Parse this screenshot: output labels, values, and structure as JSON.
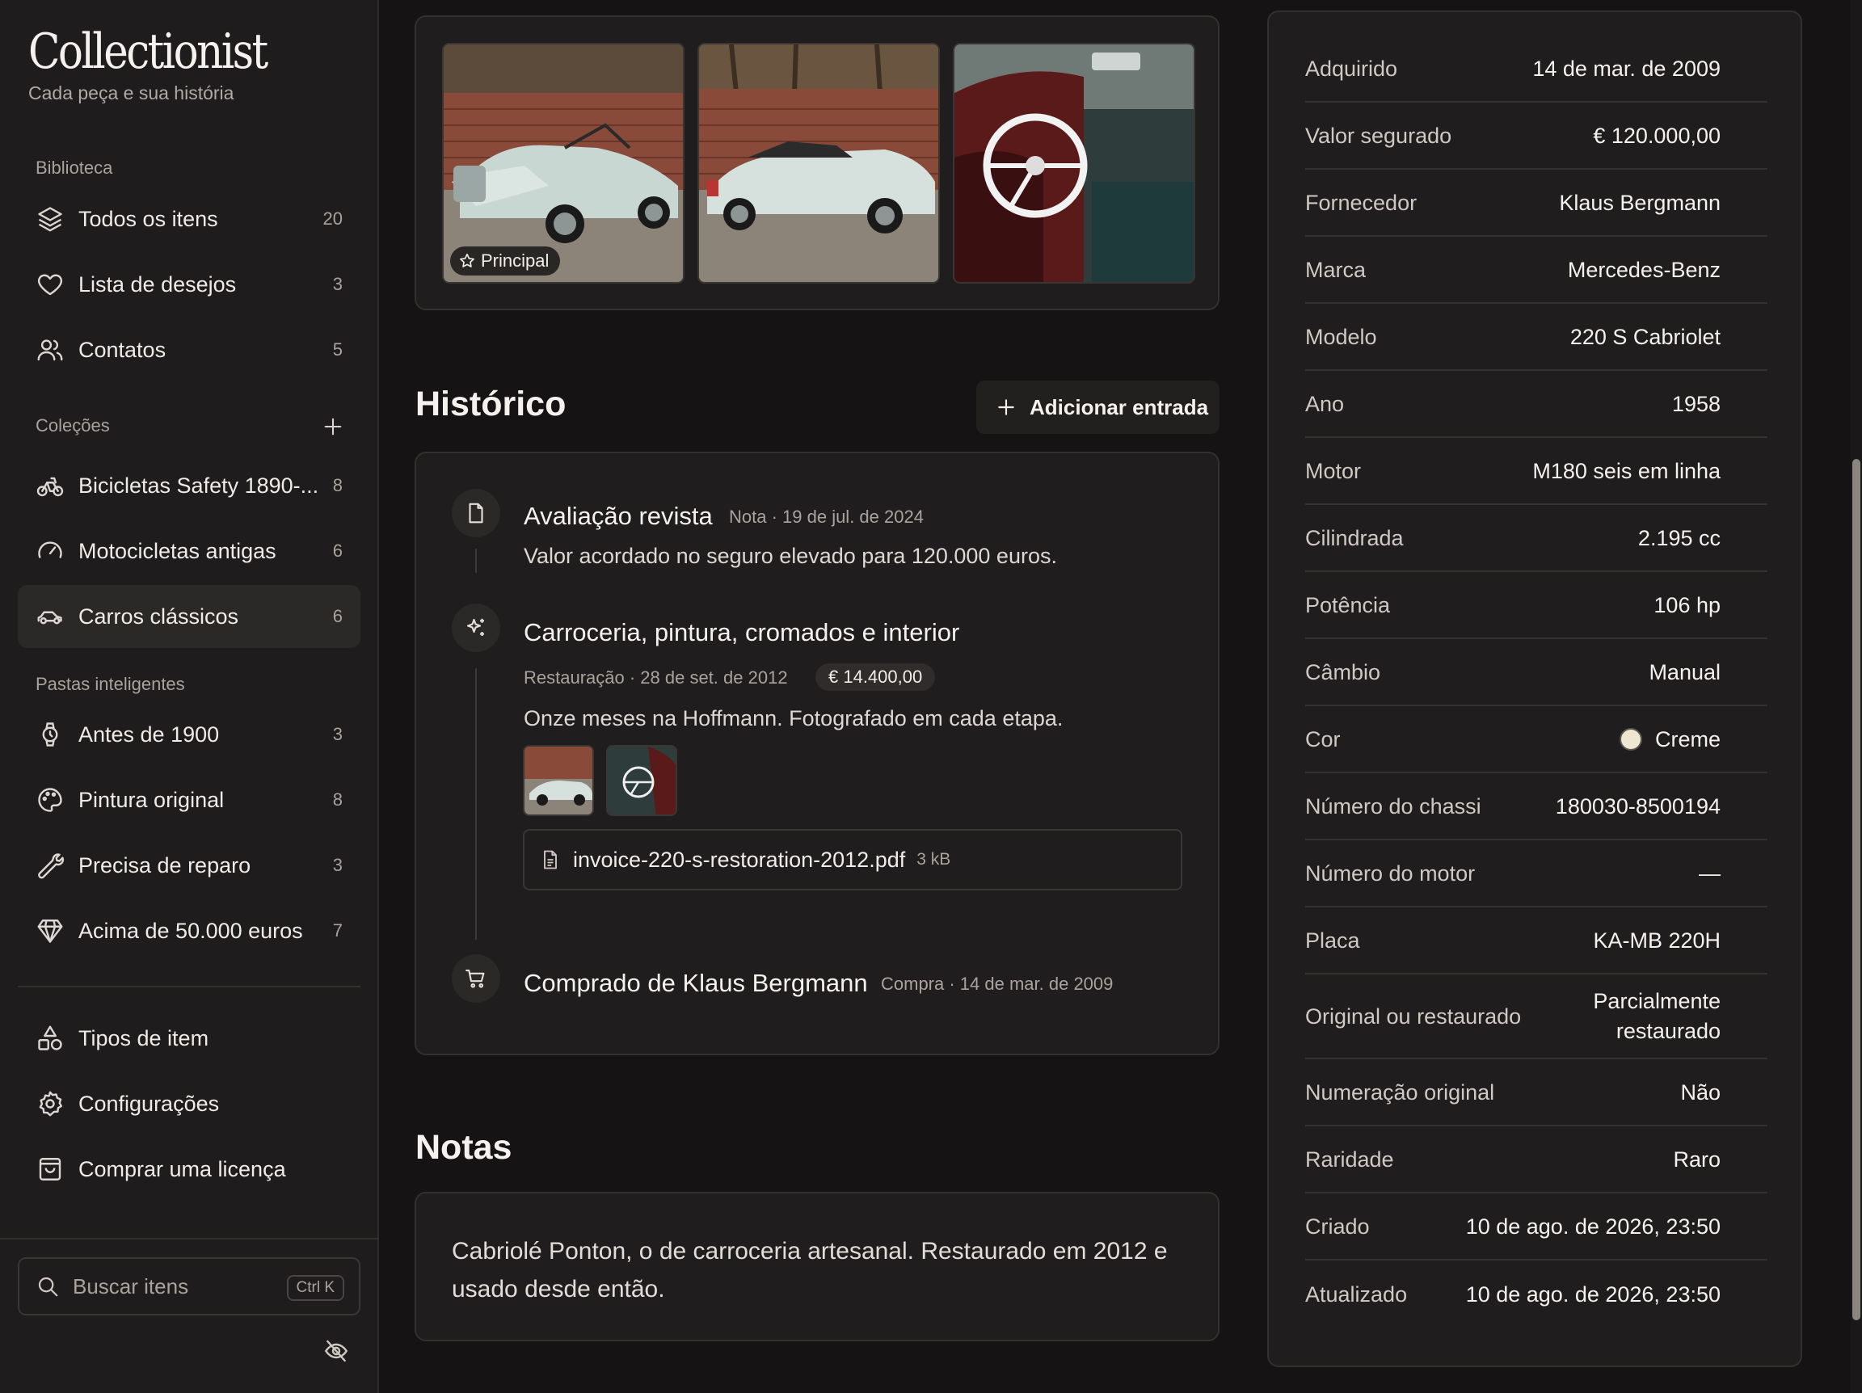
{
  "brand": {
    "name": "Collectionist",
    "tagline": "Cada peça e sua história"
  },
  "sidebar": {
    "library_label": "Biblioteca",
    "library": [
      {
        "icon": "layers-icon",
        "label": "Todos os itens",
        "count": "20"
      },
      {
        "icon": "heart-icon",
        "label": "Lista de desejos",
        "count": "3"
      },
      {
        "icon": "users-icon",
        "label": "Contatos",
        "count": "5"
      }
    ],
    "collections_label": "Coleções",
    "collections": [
      {
        "icon": "bicycle-icon",
        "label": "Bicicletas Safety 1890-...",
        "count": "8"
      },
      {
        "icon": "gauge-icon",
        "label": "Motocicletas antigas",
        "count": "6"
      },
      {
        "icon": "car-icon",
        "label": "Carros clássicos",
        "count": "6",
        "active": true
      }
    ],
    "smart_label": "Pastas inteligentes",
    "smart": [
      {
        "icon": "watch-icon",
        "label": "Antes de 1900",
        "count": "3"
      },
      {
        "icon": "palette-icon",
        "label": "Pintura original",
        "count": "8"
      },
      {
        "icon": "wrench-icon",
        "label": "Precisa de reparo",
        "count": "3"
      },
      {
        "icon": "diamond-icon",
        "label": "Acima de 50.000 euros",
        "count": "7"
      }
    ],
    "footer": [
      {
        "icon": "shapes-icon",
        "label": "Tipos de item"
      },
      {
        "icon": "gear-icon",
        "label": "Configurações"
      },
      {
        "icon": "shopping-bag-icon",
        "label": "Comprar uma licença"
      }
    ],
    "search": {
      "placeholder": "Buscar itens",
      "shortcut": "Ctrl K"
    }
  },
  "gallery": {
    "primary_badge": "Principal"
  },
  "history": {
    "title": "Histórico",
    "add_label": "Adicionar entrada",
    "events": [
      {
        "icon": "file-icon",
        "title": "Avaliação revista",
        "meta": "Nota · 19 de jul. de 2024",
        "text": "Valor acordado no seguro elevado para 120.000 euros."
      },
      {
        "icon": "sparkles-icon",
        "title": "Carroceria, pintura, cromados e interior",
        "meta": "Restauração · 28 de set. de 2012",
        "price": "€ 14.400,00",
        "text": "Onze meses na Hoffmann. Fotografado em cada etapa.",
        "attachment": {
          "name": "invoice-220-s-restoration-2012.pdf",
          "size": "3 kB"
        }
      },
      {
        "icon": "cart-icon",
        "title": "Comprado de Klaus Bergmann",
        "meta": "Compra · 14 de mar. de 2009"
      }
    ]
  },
  "notes": {
    "title": "Notas",
    "text": "Cabriolé Ponton, o de carroceria artesanal. Restaurado em 2012 e usado desde então."
  },
  "details": [
    {
      "key": "Adquirido",
      "value": "14 de mar. de 2009"
    },
    {
      "key": "Valor segurado",
      "value": "€ 120.000,00"
    },
    {
      "key": "Fornecedor",
      "value": "Klaus Bergmann"
    },
    {
      "key": "Marca",
      "value": "Mercedes-Benz"
    },
    {
      "key": "Modelo",
      "value": "220 S Cabriolet"
    },
    {
      "key": "Ano",
      "value": "1958"
    },
    {
      "key": "Motor",
      "value": "M180 seis em linha"
    },
    {
      "key": "Cilindrada",
      "value": "2.195 cc"
    },
    {
      "key": "Potência",
      "value": "106 hp"
    },
    {
      "key": "Câmbio",
      "value": "Manual"
    },
    {
      "key": "Cor",
      "value": "Creme",
      "swatch": "#efe6d2"
    },
    {
      "key": "Número do chassi",
      "value": "180030-8500194"
    },
    {
      "key": "Número do motor",
      "value": "—"
    },
    {
      "key": "Placa",
      "value": "KA-MB 220H"
    },
    {
      "key": "Original ou restaurado",
      "value_line1": "Parcialmente",
      "value_line2": "restaurado"
    },
    {
      "key": "Numeração original",
      "value": "Não"
    },
    {
      "key": "Raridade",
      "value": "Raro"
    },
    {
      "key": "Criado",
      "value": "10 de ago. de 2026, 23:50"
    },
    {
      "key": "Atualizado",
      "value": "10 de ago. de 2026, 23:50"
    }
  ],
  "colors": {
    "background": "#151313",
    "panel": "#1f1d1d",
    "border": "#34302e",
    "text": "#f4f1ee",
    "muted": "#a9a39d"
  }
}
